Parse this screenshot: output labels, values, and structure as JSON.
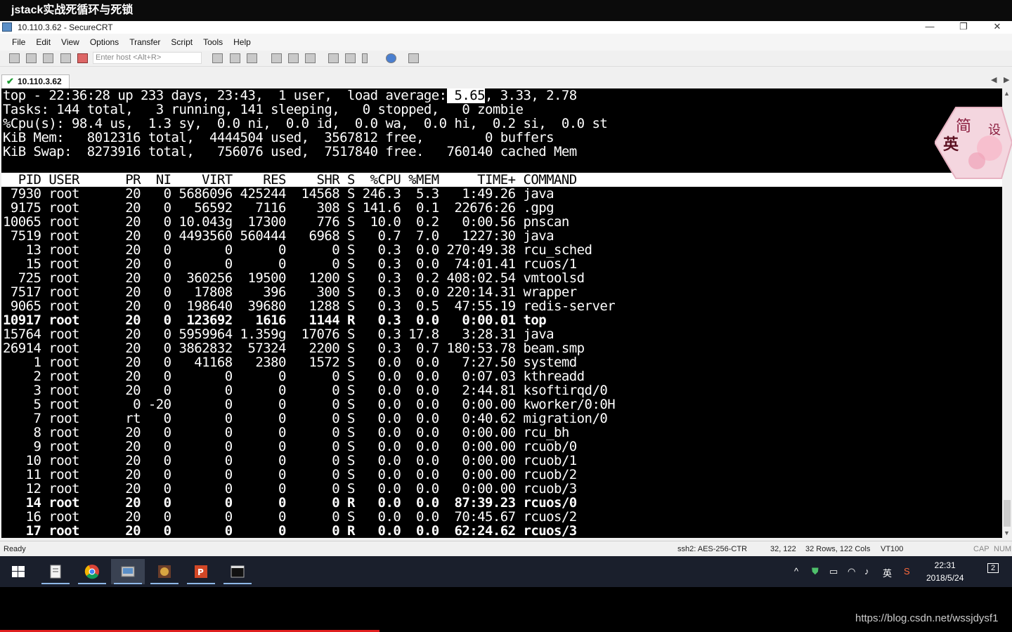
{
  "video_title": "jstack实战死循环与死锁",
  "window": {
    "title": "10.110.3.62 - SecureCRT",
    "minimize": "—",
    "maximize": "❐",
    "close": "✕"
  },
  "menu": [
    "File",
    "Edit",
    "View",
    "Options",
    "Transfer",
    "Script",
    "Tools",
    "Help"
  ],
  "toolbar": {
    "host_placeholder": "Enter host <Alt+R>"
  },
  "tab": {
    "label": "10.110.3.62"
  },
  "terminal": {
    "top_prefix": "top - 22:36:28 up 233 days, 23:43,  1 user,  load average:",
    "load_avg_1": " 5.65",
    "top_suffix": ", 3.33, 2.78",
    "tasks": "Tasks: 144 total,   3 running, 141 sleeping,   0 stopped,   0 zombie",
    "cpu": "%Cpu(s): 98.4 us,  1.3 sy,  0.0 ni,  0.0 id,  0.0 wa,  0.0 hi,  0.2 si,  0.0 st",
    "mem": "KiB Mem:   8012316 total,  4444504 used,  3567812 free,        0 buffers",
    "swap": "KiB Swap:  8273916 total,   756076 used,  7517840 free.   760140 cached Mem",
    "header": "  PID USER      PR  NI    VIRT    RES    SHR S  %CPU %MEM     TIME+ COMMAND",
    "rows": [
      " 7930 root      20   0 5686096 425244  14568 S 246.3  5.3   1:49.26 java",
      " 9175 root      20   0   56592   7116    308 S 141.6  0.1  22676:26 .gpg",
      "10065 root      20   0 10.043g  17300    776 S  10.0  0.2   0:00.56 pnscan",
      " 7519 root      20   0 4493560 560444   6968 S   0.7  7.0   1227:30 java",
      "   13 root      20   0       0      0      0 S   0.3  0.0 270:49.38 rcu_sched",
      "   15 root      20   0       0      0      0 S   0.3  0.0  74:01.41 rcuos/1",
      "  725 root      20   0  360256  19500   1200 S   0.3  0.2 408:02.54 vmtoolsd",
      " 7517 root      20   0   17808    396    300 S   0.3  0.0 220:14.31 wrapper",
      " 9065 root      20   0  198640  39680   1288 S   0.3  0.5  47:55.19 redis-server",
      "10917 root      20   0  123692   1616   1144 R   0.3  0.0   0:00.01 top",
      "15764 root      20   0 5959964 1.359g  17076 S   0.3 17.8   3:28.31 java",
      "26914 root      20   0 3862832  57324   2200 S   0.3  0.7 180:53.78 beam.smp",
      "    1 root      20   0   41168   2380   1572 S   0.0  0.0   7:27.50 systemd",
      "    2 root      20   0       0      0      0 S   0.0  0.0   0:07.03 kthreadd",
      "    3 root      20   0       0      0      0 S   0.0  0.0   2:44.81 ksoftirqd/0",
      "    5 root       0 -20       0      0      0 S   0.0  0.0   0:00.00 kworker/0:0H",
      "    7 root      rt   0       0      0      0 S   0.0  0.0   0:40.62 migration/0",
      "    8 root      20   0       0      0      0 S   0.0  0.0   0:00.00 rcu_bh",
      "    9 root      20   0       0      0      0 S   0.0  0.0   0:00.00 rcuob/0",
      "   10 root      20   0       0      0      0 S   0.0  0.0   0:00.00 rcuob/1",
      "   11 root      20   0       0      0      0 S   0.0  0.0   0:00.00 rcuob/2",
      "   12 root      20   0       0      0      0 S   0.0  0.0   0:00.00 rcuob/3",
      "   14 root      20   0       0      0      0 R   0.0  0.0  87:39.23 rcuos/0",
      "   16 root      20   0       0      0      0 S   0.0  0.0  70:45.67 rcuos/2",
      "   17 root      20   0       0      0      0 R   0.0  0.0  62:24.62 rcuos/3"
    ],
    "bold_rows": [
      9,
      22,
      24
    ]
  },
  "statusbar": {
    "ready": "Ready",
    "cipher": "ssh2: AES-256-CTR",
    "cursor": "32, 122",
    "dims": "32 Rows, 122 Cols",
    "emulation": "VT100",
    "cap": "CAP",
    "num": "NUM"
  },
  "badge": {
    "text1": "简",
    "text2": "英",
    "text3": "设"
  },
  "tray": {
    "ime": "英",
    "time": "22:31",
    "date": "2018/5/24",
    "notif": "2"
  },
  "watermark": "https://blog.csdn.net/wssjdysf1",
  "colors": {
    "accent": "#5b8fc7",
    "progress": "#e02020",
    "taskbar": "#1a1f2c"
  }
}
